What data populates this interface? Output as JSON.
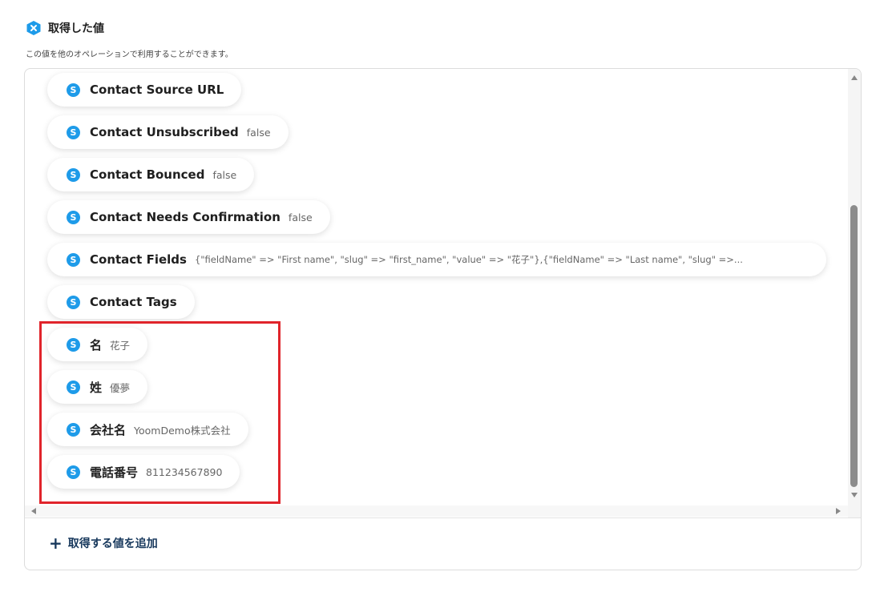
{
  "header": {
    "title": "取得した値",
    "subtitle": "この値を他のオペレーションで利用することができます。",
    "icon": "yoom-logo-icon",
    "accent_color": "#1e9be9"
  },
  "fields": [
    {
      "label": "Contact Source URL",
      "value": ""
    },
    {
      "label": "Contact Unsubscribed",
      "value": "false"
    },
    {
      "label": "Contact Bounced",
      "value": "false"
    },
    {
      "label": "Contact Needs Confirmation",
      "value": "false"
    },
    {
      "label": "Contact Fields",
      "value": "{\"fieldName\" => \"First name\", \"slug\" => \"first_name\", \"value\" => \"花子\"},{\"fieldName\" => \"Last name\", \"slug\" =>..."
    },
    {
      "label": "Contact Tags",
      "value": ""
    },
    {
      "label": "名",
      "value": "花子"
    },
    {
      "label": "姓",
      "value": "優夢"
    },
    {
      "label": "会社名",
      "value": "YoomDemo株式会社"
    },
    {
      "label": "電話番号",
      "value": "811234567890"
    }
  ],
  "field_icon_letter": "S",
  "add_button": {
    "label": "取得する値を追加",
    "icon": "plus-icon"
  },
  "highlight_color": "#e0242b"
}
